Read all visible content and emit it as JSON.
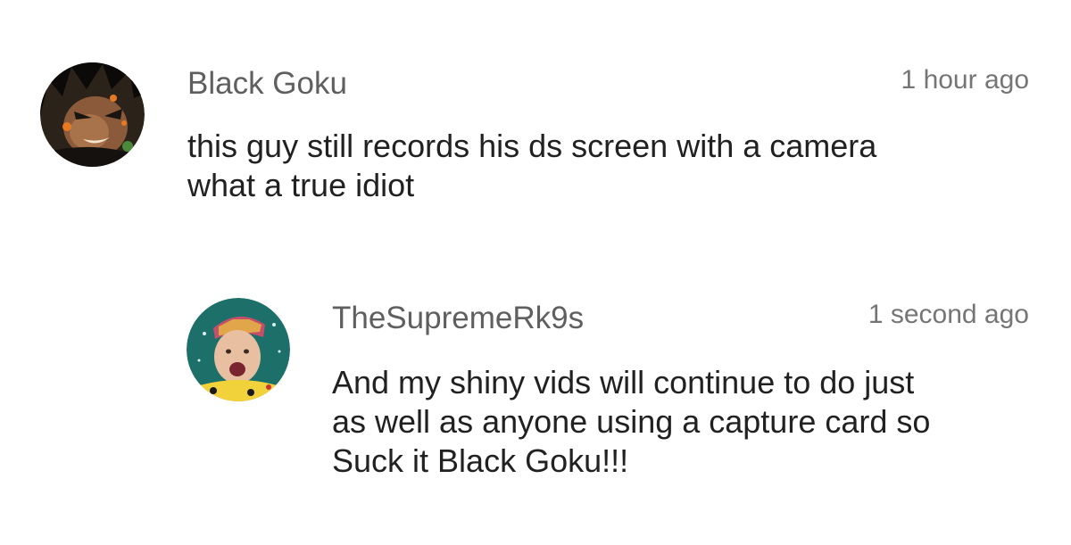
{
  "comments": [
    {
      "author": "Black Goku",
      "timestamp": "1 hour ago",
      "lines": [
        "this guy still records his ds screen with a camera",
        "what a true idiot"
      ],
      "avatar": "anime-character-avatar"
    }
  ],
  "replies": [
    {
      "author": "TheSupremeRk9s",
      "timestamp": "1 second ago",
      "lines": [
        "And my shiny vids will continue to do just",
        "as well as anyone using a capture card so",
        "Suck it Black Goku!!!"
      ],
      "avatar": "person-photo-avatar"
    }
  ]
}
